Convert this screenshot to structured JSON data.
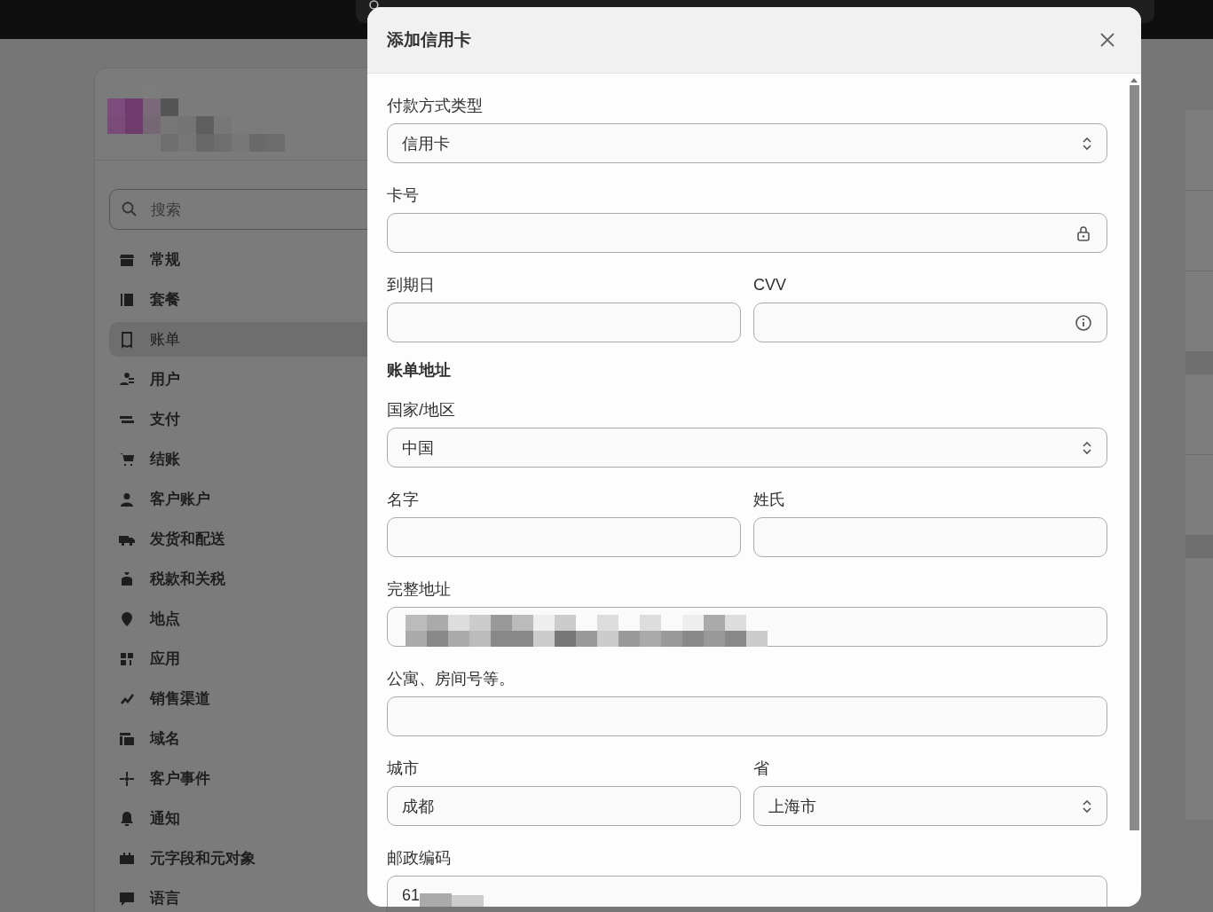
{
  "top_bar": {
    "search": {
      "kind": "field"
    }
  },
  "sidebar": {
    "search": {
      "placeholder": "搜索"
    },
    "items": [
      {
        "label": "常规",
        "selected": false
      },
      {
        "label": "套餐",
        "selected": false
      },
      {
        "label": "账单",
        "selected": true
      },
      {
        "label": "用户",
        "selected": false
      },
      {
        "label": "支付",
        "selected": false
      },
      {
        "label": "结账",
        "selected": false
      },
      {
        "label": "客户账户",
        "selected": false
      },
      {
        "label": "发货和配送",
        "selected": false
      },
      {
        "label": "税款和关税",
        "selected": false
      },
      {
        "label": "地点",
        "selected": false
      },
      {
        "label": "应用",
        "selected": false
      },
      {
        "label": "销售渠道",
        "selected": false
      },
      {
        "label": "域名",
        "selected": false
      },
      {
        "label": "客户事件",
        "selected": false
      },
      {
        "label": "通知",
        "selected": false
      },
      {
        "label": "元字段和元对象",
        "selected": false
      },
      {
        "label": "语言",
        "selected": false
      }
    ]
  },
  "dialog": {
    "title": "添加信用卡",
    "rows": [
      [
        {
          "kind": "select",
          "label": "付款方式类型",
          "value": "信用卡"
        }
      ],
      [
        {
          "kind": "secure",
          "label": "卡号"
        }
      ],
      [
        {
          "kind": "text",
          "label": "到期日"
        },
        {
          "kind": "info",
          "label": "CVV"
        }
      ],
      [
        {
          "kind": "heading",
          "label": "账单地址"
        }
      ],
      [
        {
          "kind": "select",
          "label": "国家/地区",
          "value": "中国"
        }
      ],
      [
        {
          "kind": "text",
          "label": "名字"
        },
        {
          "kind": "text",
          "label": "姓氏"
        }
      ],
      [
        {
          "kind": "redacted",
          "label": "完整地址"
        }
      ],
      [
        {
          "kind": "text",
          "label": "公寓、房间号等。"
        }
      ],
      [
        {
          "kind": "text",
          "label": "城市",
          "value": "成都"
        },
        {
          "kind": "select",
          "label": "省",
          "value": "上海市"
        }
      ],
      [
        {
          "kind": "partial",
          "label": "邮政编码",
          "value": "61"
        }
      ]
    ]
  }
}
